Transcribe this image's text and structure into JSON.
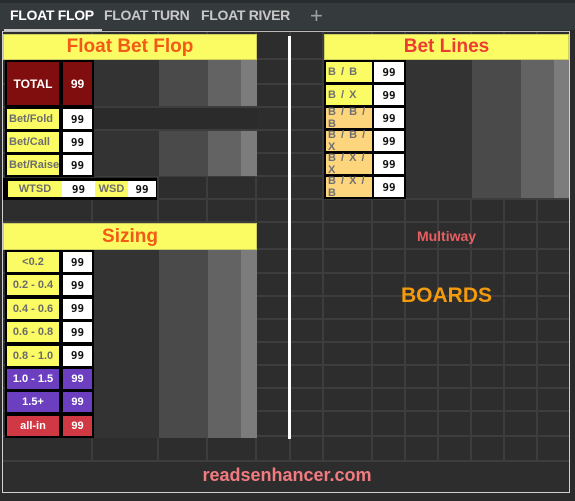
{
  "tabs": [
    {
      "label": "FLOAT FLOP",
      "active": true
    },
    {
      "label": "FLOAT TURN",
      "active": false
    },
    {
      "label": "FLOAT RIVER",
      "active": false
    }
  ],
  "add_tab_icon": "+",
  "float_bet_flop": {
    "title": "Float Bet Flop",
    "total": {
      "label": "TOTAL",
      "value": "99"
    },
    "rows": [
      {
        "label": "Bet/Fold",
        "value": "99"
      },
      {
        "label": "Bet/Call",
        "value": "99"
      },
      {
        "label": "Bet/Raise",
        "value": "99"
      }
    ],
    "wtsd": {
      "label": "WTSD",
      "value": "99"
    },
    "wsd": {
      "label": "WSD",
      "value": "99"
    }
  },
  "bet_lines": {
    "title": "Bet Lines",
    "rows": [
      {
        "label": "B / B",
        "value": "99",
        "tier": "yellow"
      },
      {
        "label": "B / X",
        "value": "99",
        "tier": "yellow"
      },
      {
        "label": "B / B / B",
        "value": "99",
        "tier": "orange"
      },
      {
        "label": "B / B / X",
        "value": "99",
        "tier": "orange"
      },
      {
        "label": "B / X / X",
        "value": "99",
        "tier": "orange"
      },
      {
        "label": "B / X / B",
        "value": "99",
        "tier": "orange"
      }
    ]
  },
  "sizing": {
    "title": "Sizing",
    "rows": [
      {
        "label": "<0.2",
        "value": "99",
        "tier": "yellow"
      },
      {
        "label": "0.2 - 0.4",
        "value": "99",
        "tier": "yellow"
      },
      {
        "label": "0.4 - 0.6",
        "value": "99",
        "tier": "yellow"
      },
      {
        "label": "0.6 - 0.8",
        "value": "99",
        "tier": "yellow"
      },
      {
        "label": "0.8 - 1.0",
        "value": "99",
        "tier": "yellow"
      },
      {
        "label": "1.0 - 1.5",
        "value": "99",
        "tier": "purple"
      },
      {
        "label": "1.5+",
        "value": "99",
        "tier": "purple"
      },
      {
        "label": "all-in",
        "value": "99",
        "tier": "red"
      }
    ]
  },
  "multiway_label": "Multiway",
  "boards_label": "BOARDS",
  "footer_link": "readsenhancer.com",
  "colors": {
    "header_bg": "#fbfc64",
    "header_text": "#f25a16",
    "bet_lines_title": "#ee3b33",
    "total_bg": "#800e0e",
    "orange_label_bg": "#fdd57c",
    "purple_bg": "#6b3fc0",
    "red_bg": "#d03844",
    "multiway_text": "#e85f62",
    "boards_text": "#f39a0d",
    "footer_text": "#f27b80"
  }
}
